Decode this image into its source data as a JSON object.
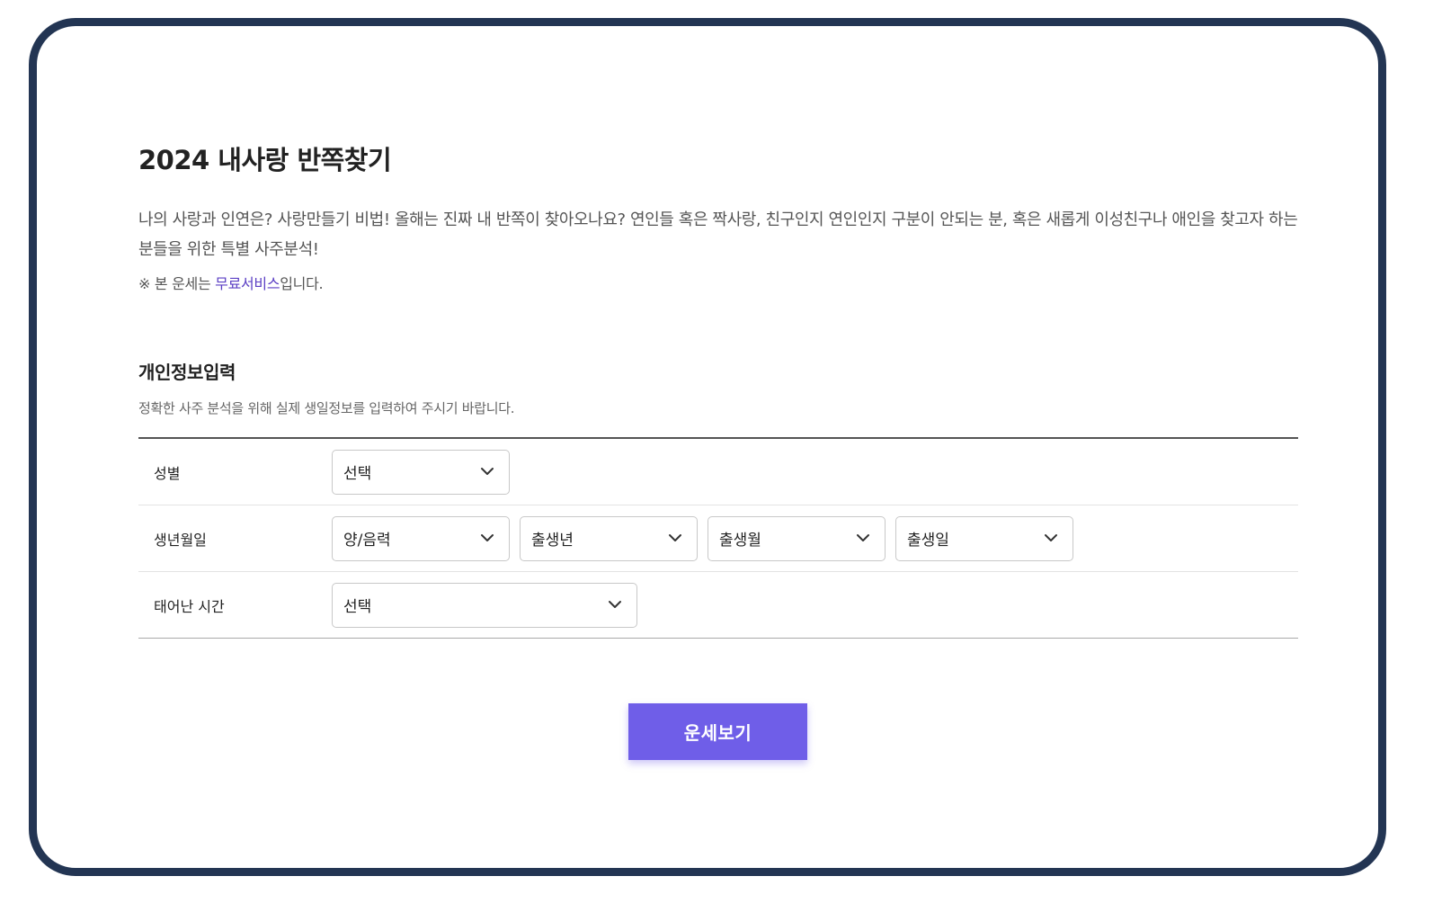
{
  "page": {
    "title": "2024 내사랑 반쪽찾기",
    "description": "나의 사랑과 인연은? 사랑만들기 비법! 올해는 진짜 내 반쪽이 찾아오나요? 연인들 혹은 짝사랑, 친구인지 연인인지 구분이 안되는 분, 혹은 새롭게 이성친구나 애인을 찾고자 하는 분들을 위한 특별 사주분석!",
    "notice_prefix": "※ 본 운세는 ",
    "notice_highlight": "무료서비스",
    "notice_suffix": "입니다."
  },
  "section": {
    "title": "개인정보입력",
    "description": "정확한 사주 분석을 위해 실제 생일정보를 입력하여 주시기 바랍니다."
  },
  "form": {
    "gender": {
      "label": "성별",
      "value": "선택"
    },
    "birth": {
      "label": "생년월일",
      "calendar": "양/음력",
      "year": "출생년",
      "month": "출생월",
      "day": "출생일"
    },
    "time": {
      "label": "태어난 시간",
      "value": "선택"
    }
  },
  "submit_label": "운세보기",
  "colors": {
    "frame_border": "#233553",
    "accent": "#6f5ee8",
    "link": "#5b3fc4"
  }
}
